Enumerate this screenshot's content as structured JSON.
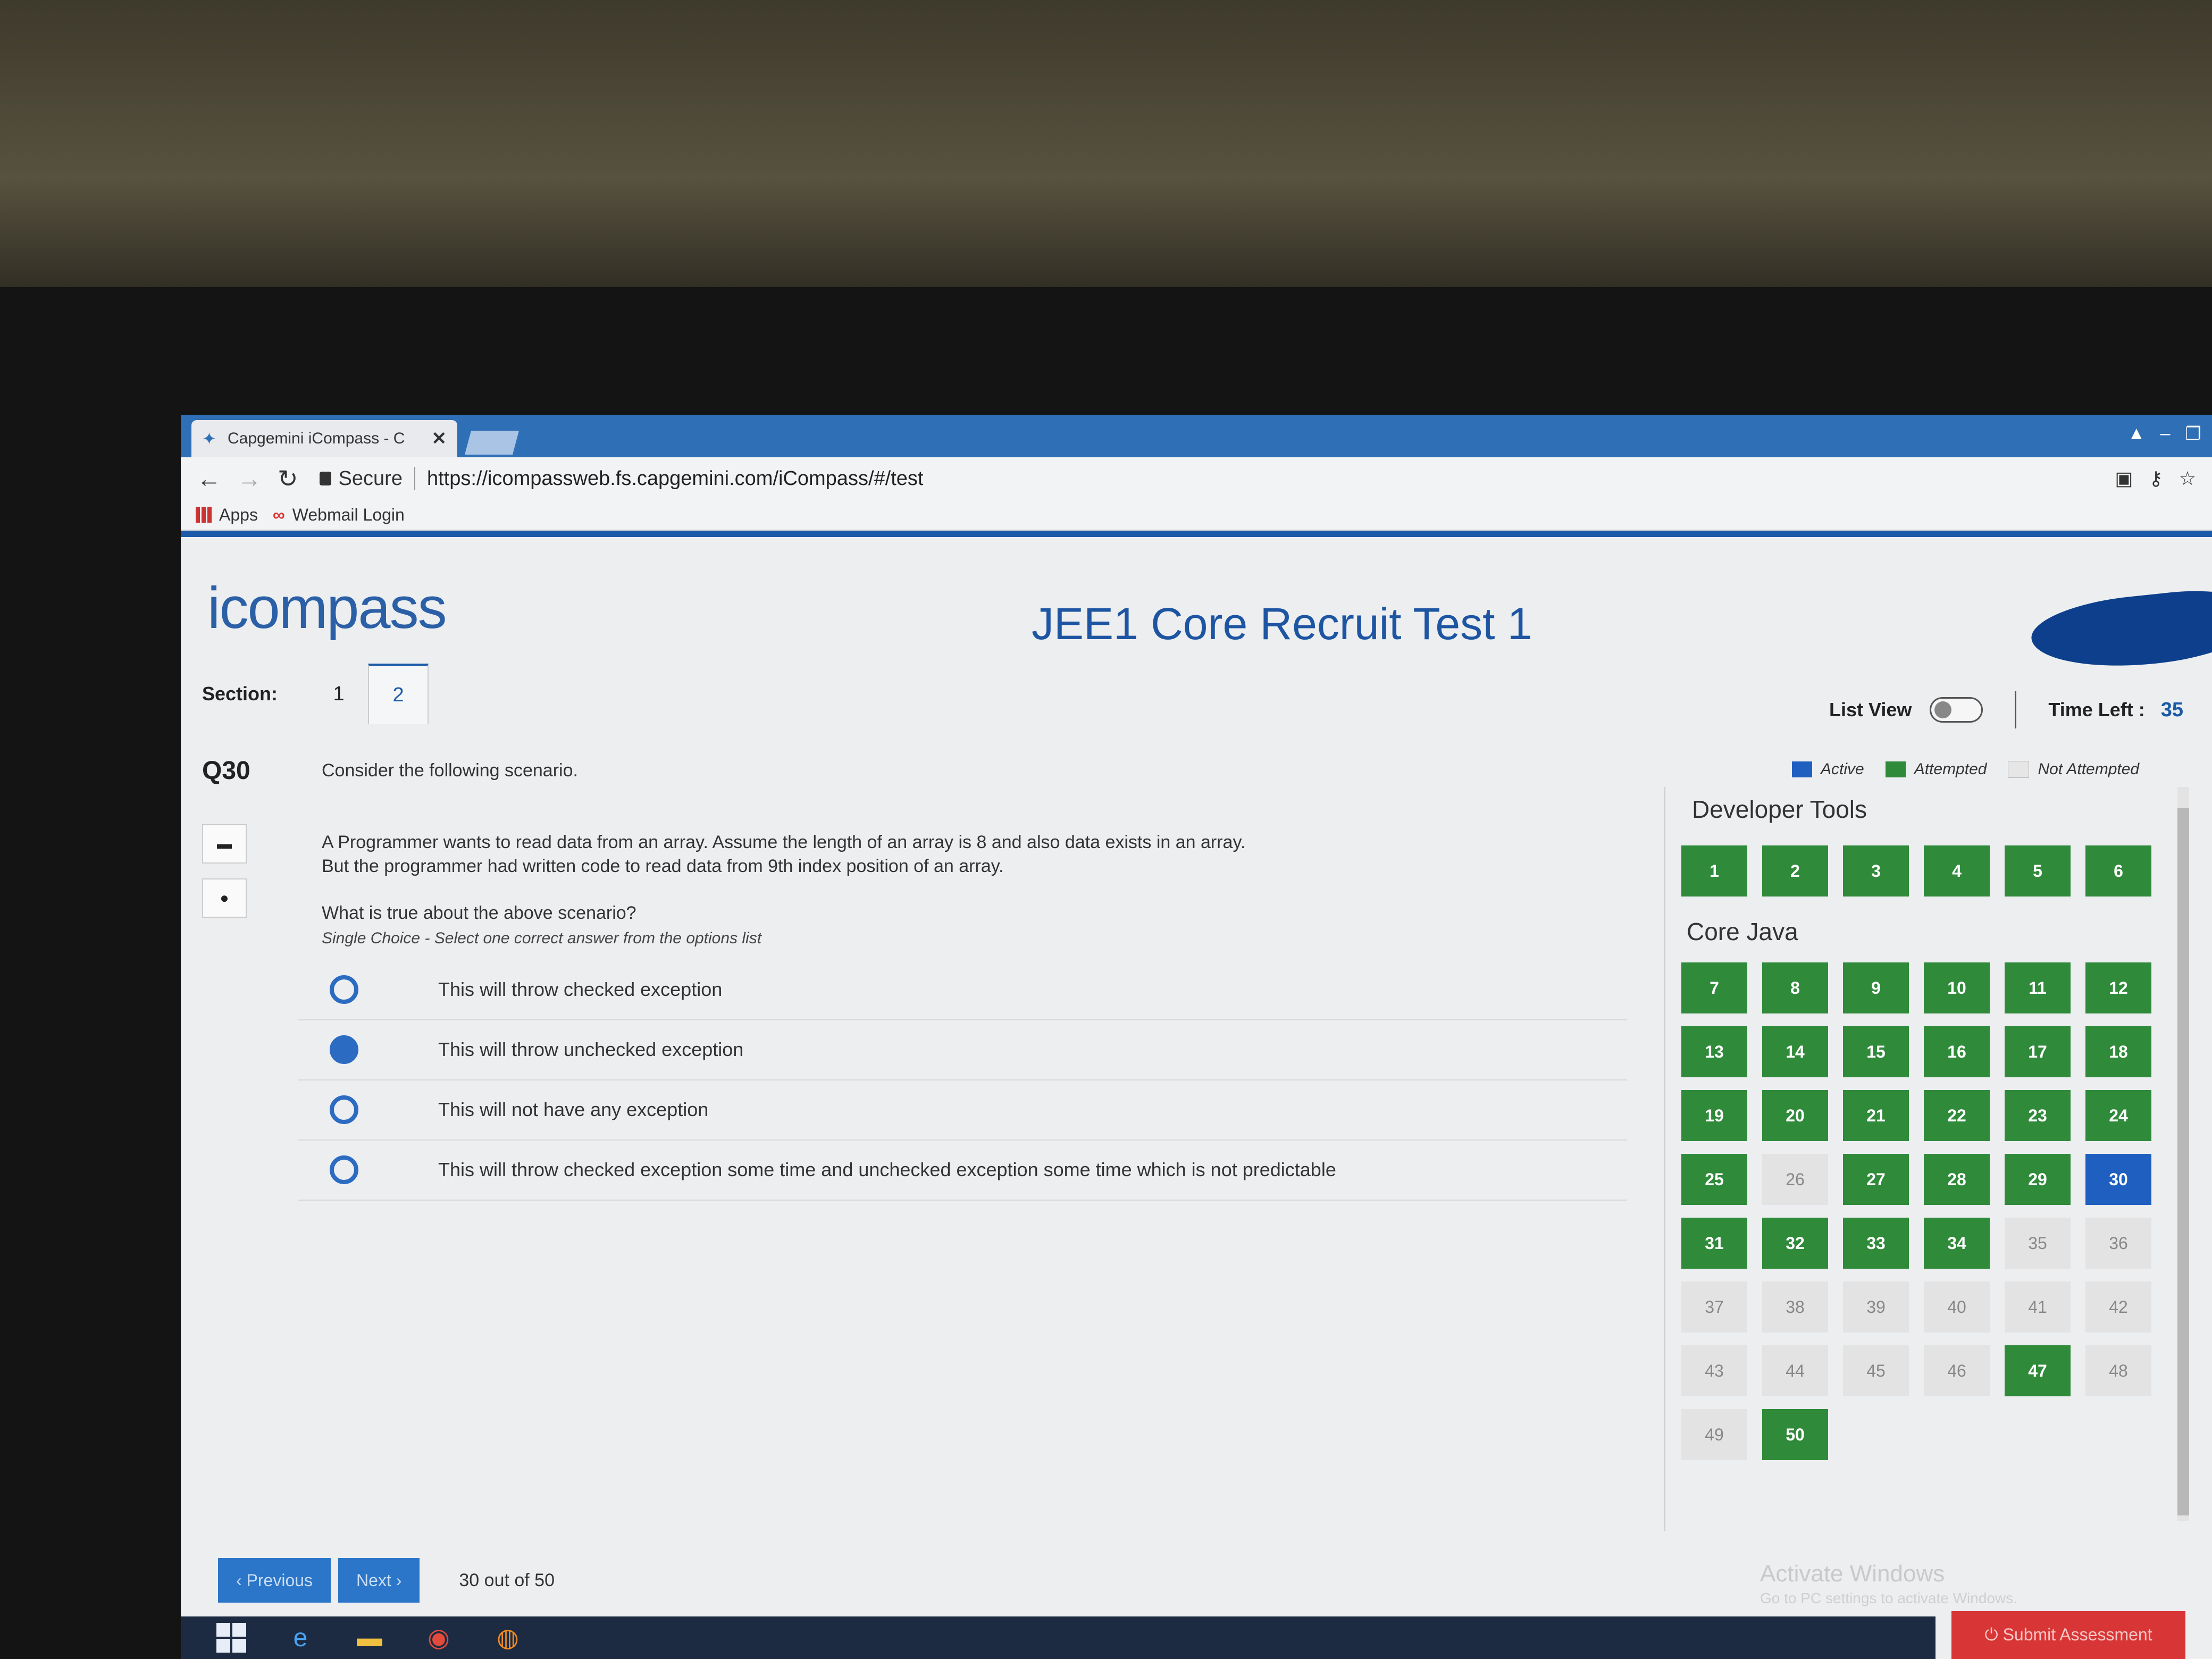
{
  "browser": {
    "tab_title": "Capgemini iCompass - C",
    "tab_close": "✕",
    "secure_label": "Secure",
    "url": "https://icompassweb.fs.capgemini.com/iCompass/#/test",
    "bookmarks": [
      "Apps",
      "Webmail Login"
    ]
  },
  "app": {
    "logo": "icompass",
    "title": "JEE1 Core Recruit Test 1",
    "section_label": "Section:",
    "sections": [
      "1",
      "2"
    ],
    "active_section": "2",
    "list_view_label": "List View",
    "list_view_on": false,
    "time_left_label": "Time Left :",
    "time_left_value": "35"
  },
  "question": {
    "number": "Q30",
    "intro": "Consider the following scenario.",
    "line1": "A Programmer wants to read data from an array. Assume the length of an array is 8 and also data exists in an array.",
    "line2": "But the programmer had written code to read data from 9th index position of an array.",
    "prompt": "What is true about the above scenario?",
    "hint": "Single Choice - Select one correct answer from the options list",
    "options": [
      {
        "text": "This will throw checked exception",
        "selected": false
      },
      {
        "text": "This will throw unchecked exception",
        "selected": true
      },
      {
        "text": "This will not have any exception",
        "selected": false
      },
      {
        "text": "This will throw checked exception some time and unchecked exception some time which is not predictable",
        "selected": false
      }
    ]
  },
  "legend": {
    "active": "Active",
    "attempted": "Attempted",
    "not_attempted": "Not Attempted"
  },
  "palette": {
    "groups": [
      {
        "title": "Developer Tools",
        "start": 1,
        "end": 6
      },
      {
        "title": "Core Java",
        "start": 7,
        "end": 50
      }
    ],
    "attempted": [
      1,
      2,
      3,
      4,
      5,
      6,
      7,
      8,
      9,
      10,
      11,
      12,
      13,
      14,
      15,
      16,
      17,
      18,
      19,
      20,
      21,
      22,
      23,
      24,
      25,
      27,
      28,
      29,
      31,
      32,
      33,
      34,
      47,
      50
    ],
    "active": 30
  },
  "footer": {
    "prev": "‹ Previous",
    "next": "Next ›",
    "counter": "30 out of 50",
    "submit": "⏻ Submit Assessment",
    "activate_title": "Activate Windows",
    "activate_sub": "Go to PC settings to activate Windows."
  },
  "colors": {
    "attempted": "#2f8a3a",
    "active": "#1f5fbf",
    "not_attempted": "#e3e3e3",
    "brand": "#1d55a2"
  }
}
